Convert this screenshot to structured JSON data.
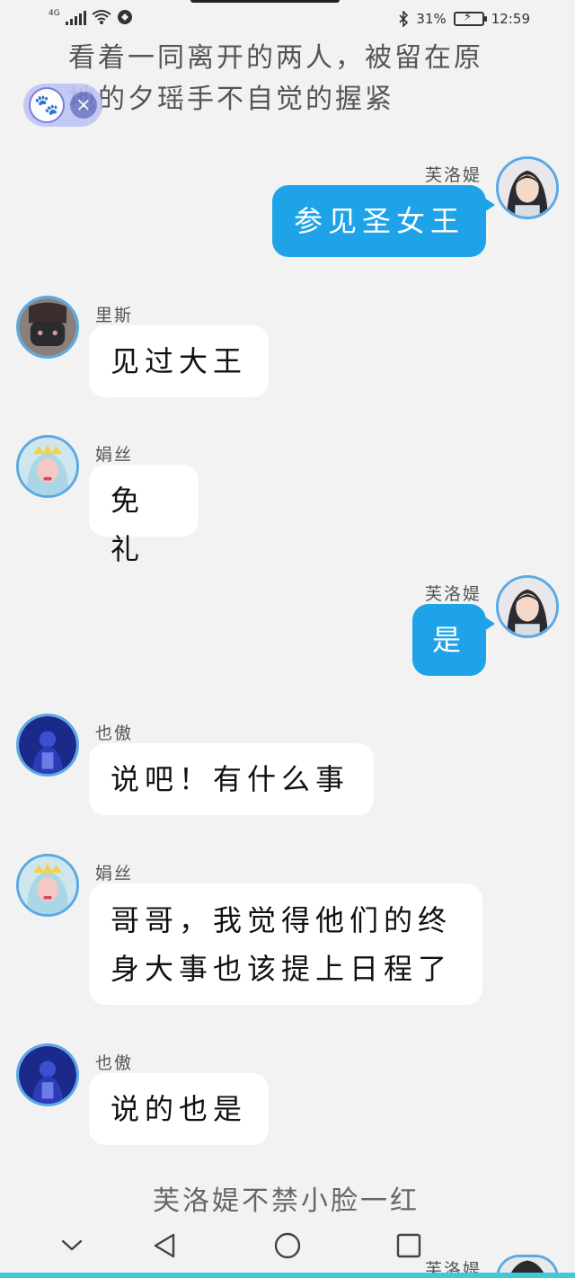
{
  "status_bar": {
    "network": "4G",
    "battery_percent": "31%",
    "time": "12:59"
  },
  "narration": {
    "top_line1": "看着一同离开的两人，被留在原",
    "top_line2": "地的夕瑶手不自觉的握紧",
    "bottom": "芙洛媞不禁小脸一红"
  },
  "messages": [
    {
      "side": "right",
      "name": "芙洛媞",
      "text": "参见圣女王",
      "avatar": "girl-avatar"
    },
    {
      "side": "left",
      "name": "里斯",
      "text": "见过大王",
      "avatar": "masked-man-avatar"
    },
    {
      "side": "left",
      "name": "娟丝",
      "text": "免礼",
      "avatar": "queen-avatar"
    },
    {
      "side": "right",
      "name": "芙洛媞",
      "text": "是",
      "avatar": "girl-avatar"
    },
    {
      "side": "left",
      "name": "也傲",
      "text": "说吧！有什么事",
      "avatar": "king-avatar"
    },
    {
      "side": "left",
      "name": "娟丝",
      "text_line1": "哥哥，我觉得他们的终",
      "text_line2": "身大事也该提上日程了",
      "avatar": "queen-avatar"
    },
    {
      "side": "left",
      "name": "也傲",
      "text": "说的也是",
      "avatar": "king-avatar"
    },
    {
      "side": "right",
      "name": "芙洛媞",
      "avatar": "girl-avatar"
    }
  ],
  "nav": {
    "items": [
      "chevron-down-icon",
      "back-icon",
      "home-icon",
      "recents-icon"
    ]
  },
  "colors": {
    "accent_bubble": "#1fa3e8",
    "avatar_ring": "#5aa9e6",
    "background": "#f2f2f2",
    "bottom_strip": "#3ec8d8"
  }
}
